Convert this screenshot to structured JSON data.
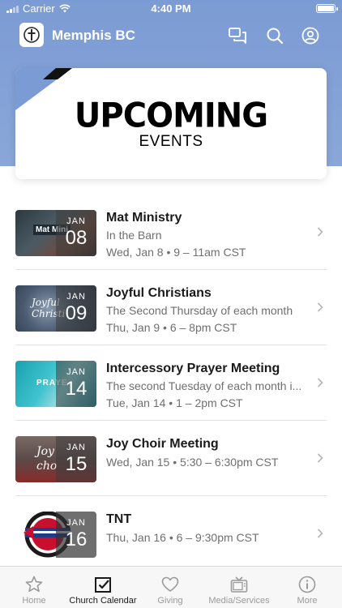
{
  "status_bar": {
    "carrier": "Carrier",
    "time": "4:40 PM"
  },
  "app": {
    "title": "Memphis BC"
  },
  "banner": {
    "headline": "UPCOMING",
    "subline": "EVENTS"
  },
  "events": [
    {
      "month": "JAN",
      "day": "08",
      "title": "Mat Ministry",
      "subtitle": "In the Barn",
      "when": "Wed, Jan 8 • 9 – 11am CST",
      "thumb_text": "Mat Mini"
    },
    {
      "month": "JAN",
      "day": "09",
      "title": "Joyful Christians",
      "subtitle": "The Second Thursday of each month",
      "when": "Thu, Jan 9 • 6 – 8pm CST",
      "thumb_text": "Joyful Christi"
    },
    {
      "month": "JAN",
      "day": "14",
      "title": "Intercessory Prayer Meeting",
      "subtitle": "The second Tuesday of each  month i...",
      "when": "Tue, Jan 14 • 1 – 2pm CST",
      "thumb_text": "PRAYE"
    },
    {
      "month": "JAN",
      "day": "15",
      "title": "Joy Choir Meeting",
      "subtitle": "",
      "when": "Wed, Jan 15 • 5:30 – 6:30pm CST",
      "thumb_text": "Joy cho"
    },
    {
      "month": "JAN",
      "day": "16",
      "title": "TNT",
      "subtitle": "",
      "when": "Thu, Jan 16 • 6 – 9:30pm CST",
      "thumb_text": ""
    }
  ],
  "tabs": [
    {
      "label": "Home",
      "icon": "star-icon",
      "active": false
    },
    {
      "label": "Church Calendar",
      "icon": "calendar-check-icon",
      "active": true
    },
    {
      "label": "Giving",
      "icon": "heart-icon",
      "active": false
    },
    {
      "label": "Media/Services",
      "icon": "tv-icon",
      "active": false
    },
    {
      "label": "More",
      "icon": "info-icon",
      "active": false
    }
  ],
  "colors": {
    "header": "#7b9bd4",
    "accent": "#1a1a1a",
    "muted": "#6f6f6f"
  }
}
